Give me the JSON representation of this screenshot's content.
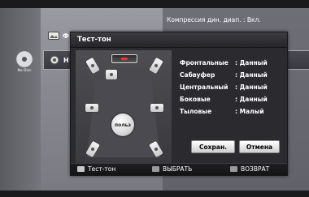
{
  "background": {
    "setting_text": "Компрессия дин. диап.  :  Вкл.",
    "menu_items": [
      {
        "label": "Ф",
        "icon": "photo-icon"
      },
      {
        "label": "Н",
        "icon": "settings-gear-icon"
      }
    ],
    "disc_label": "No Disc"
  },
  "popup": {
    "title": "Тест-тон",
    "user_label": "польз",
    "rows": [
      {
        "label": "Фронтальные",
        "value": ": Данный"
      },
      {
        "label": "Сабвуфер",
        "value": ": Данный"
      },
      {
        "label": "Центральный",
        "value": ": Данный"
      },
      {
        "label": "Боковые",
        "value": ": Данный"
      },
      {
        "label": "Тыловые",
        "value": ": Малый"
      }
    ],
    "buttons": {
      "save": "Сохран.",
      "cancel": "Отмена"
    }
  },
  "footer": [
    {
      "label": "Тест-тон",
      "key_color": "#c8c8c8"
    },
    {
      "label": "ВЫБРАТЬ",
      "key_color": "#9a9a9a"
    },
    {
      "label": "ВОЗВРАТ",
      "key_color": "#9a9a9a"
    }
  ]
}
